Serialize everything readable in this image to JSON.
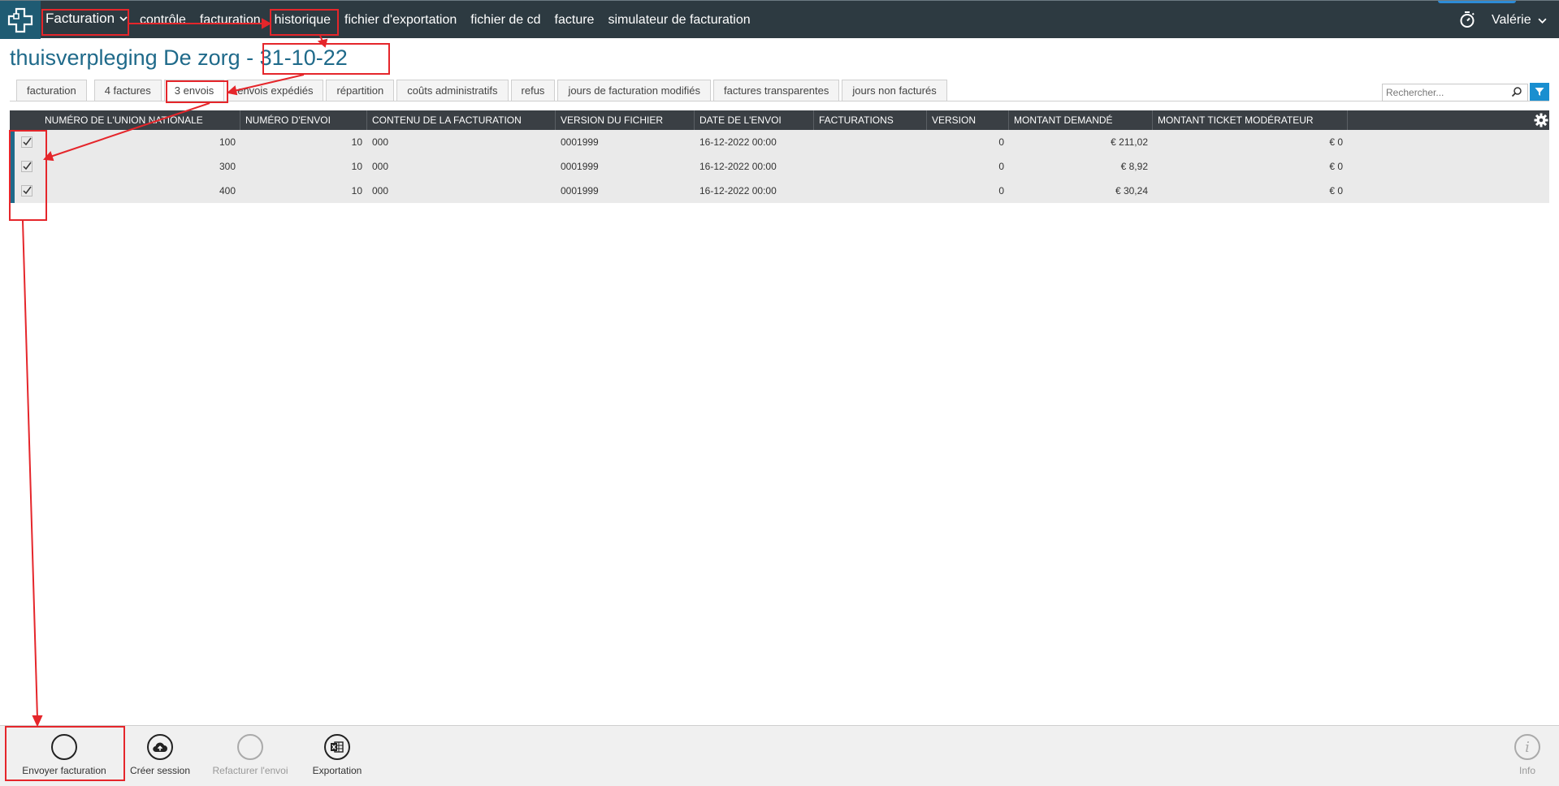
{
  "header": {
    "app_name": "Facturation",
    "nav": [
      "contrôle",
      "facturation",
      "historique",
      "fichier d'exportation",
      "fichier de cd",
      "facture",
      "simulateur de facturation"
    ],
    "user": "Valérie"
  },
  "page": {
    "title_prefix": "thuisverpleging De zorg - ",
    "title_date": "31-10-22"
  },
  "tabs": [
    "facturation",
    "4 factures",
    "3 envois",
    "envois expédiés",
    "répartition",
    "coûts administratifs",
    "refus",
    "jours de facturation modifiés",
    "factures transparentes",
    "jours non facturés"
  ],
  "active_tab": "3 envois",
  "search": {
    "placeholder": "Rechercher..."
  },
  "grid": {
    "columns": [
      "NUMÉRO DE L'UNION NATIONALE",
      "NUMÉRO D'ENVOI",
      "CONTENU DE LA FACTURATION",
      "VERSION DU FICHIER",
      "DATE DE L'ENVOI",
      "FACTURATIONS",
      "VERSION",
      "MONTANT DEMANDÉ",
      "MONTANT TICKET MODÉRATEUR"
    ],
    "rows": [
      {
        "union": "100",
        "envoi": "10",
        "contenu": "000",
        "fichier": "0001999",
        "date": "16-12-2022 00:00",
        "facturations": "",
        "version": "0",
        "montant": "€ 211,02",
        "ticket": "€ 0"
      },
      {
        "union": "300",
        "envoi": "10",
        "contenu": "000",
        "fichier": "0001999",
        "date": "16-12-2022 00:00",
        "facturations": "",
        "version": "0",
        "montant": "€ 8,92",
        "ticket": "€ 0"
      },
      {
        "union": "400",
        "envoi": "10",
        "contenu": "000",
        "fichier": "0001999",
        "date": "16-12-2022 00:00",
        "facturations": "",
        "version": "0",
        "montant": "€ 30,24",
        "ticket": "€ 0"
      }
    ]
  },
  "toolbar": {
    "envoyer": "Envoyer facturation",
    "creer": "Créer session",
    "refacturer": "Refacturer l'envoi",
    "exportation": "Exportation",
    "info": "Info"
  },
  "colors": {
    "topbar": "#2d3a41",
    "accent": "#1f6a8a",
    "annotation": "#e5262b",
    "filter": "#1a8fd0"
  }
}
